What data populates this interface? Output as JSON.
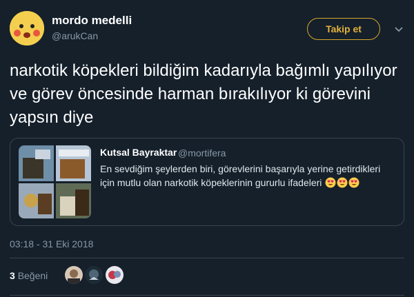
{
  "author": {
    "display_name": "mordo medelli",
    "handle": "@arukCan"
  },
  "follow_button": {
    "label": "Takip et"
  },
  "tweet": {
    "text": "narkotik köpekleri bildiğim kadarıyla bağımlı yapılıyor ve görev öncesinde harman bırakılıyor ki görevini yapsın diye",
    "timestamp": "03:18 - 31 Eki 2018"
  },
  "quoted_tweet": {
    "display_name": "Kutsal Bayraktar",
    "handle": "@mortifera",
    "text": "En sevdiğim şeylerden biri, görevlerini başarıyla yerine getirdikleri için mutlu olan narkotik köpeklerinin gururlu ifadeleri",
    "emojis": [
      "heart-eyes-emoji",
      "heart-eyes-emoji",
      "heart-eyes-emoji"
    ]
  },
  "engagement": {
    "likes_count": "3",
    "likes_label": "Beğeni"
  },
  "colors": {
    "background": "#15202b",
    "follow_accent": "#e4b13b",
    "secondary_text": "#8899a6",
    "border": "#38444d"
  }
}
